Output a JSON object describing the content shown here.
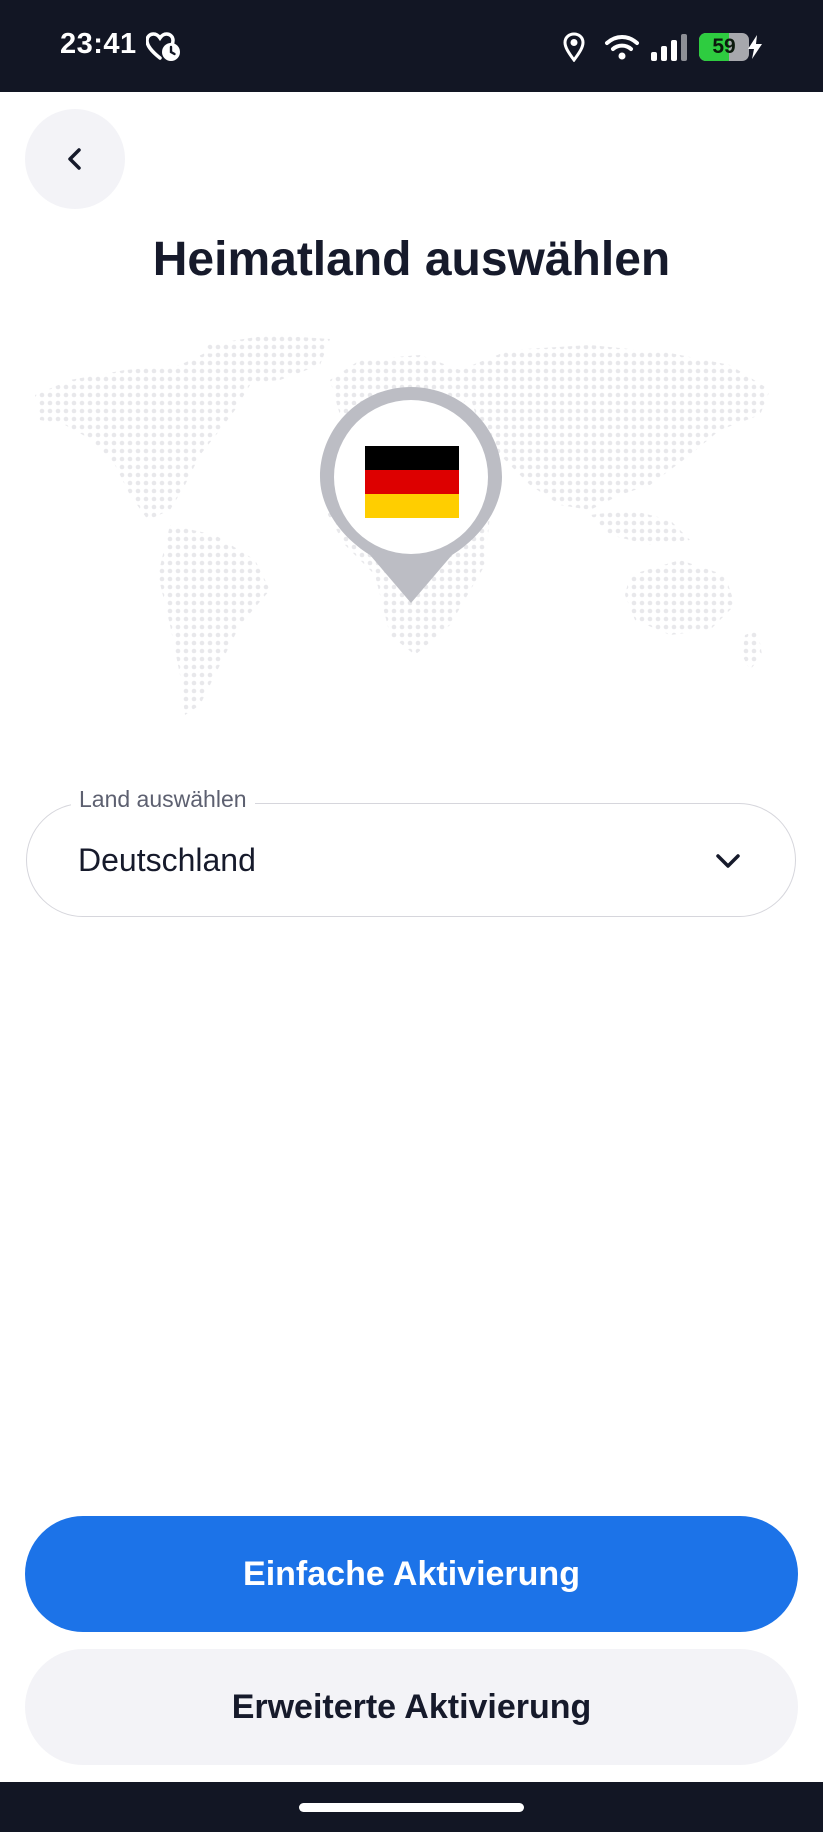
{
  "status_bar": {
    "time": "23:41",
    "battery_level": "59",
    "battery_fraction": 0.59,
    "icons": [
      "notification-heart-clock-icon",
      "location-icon",
      "wifi-icon",
      "signal-icon",
      "battery-icon",
      "charging-bolt-icon"
    ]
  },
  "header": {
    "back_icon": "chevron-left-icon",
    "title": "Heimatland auswählen"
  },
  "illustration": {
    "map_icon": "world-map-dotted",
    "pin_icon": "map-pin-icon",
    "flag": "germany-flag",
    "flag_colors": [
      "#000000",
      "#dd0000",
      "#ffce00"
    ]
  },
  "country_select": {
    "label": "Land auswählen",
    "value": "Deutschland",
    "icon": "chevron-down-icon"
  },
  "actions": {
    "primary_label": "Einfache Aktivierung",
    "secondary_label": "Erweiterte Aktivierung"
  },
  "colors": {
    "status_bar_bg": "#121624",
    "primary_button": "#1c73e8",
    "secondary_button": "#f3f3f7",
    "text_dark": "#161a2b",
    "battery_green": "#2ecc40"
  }
}
